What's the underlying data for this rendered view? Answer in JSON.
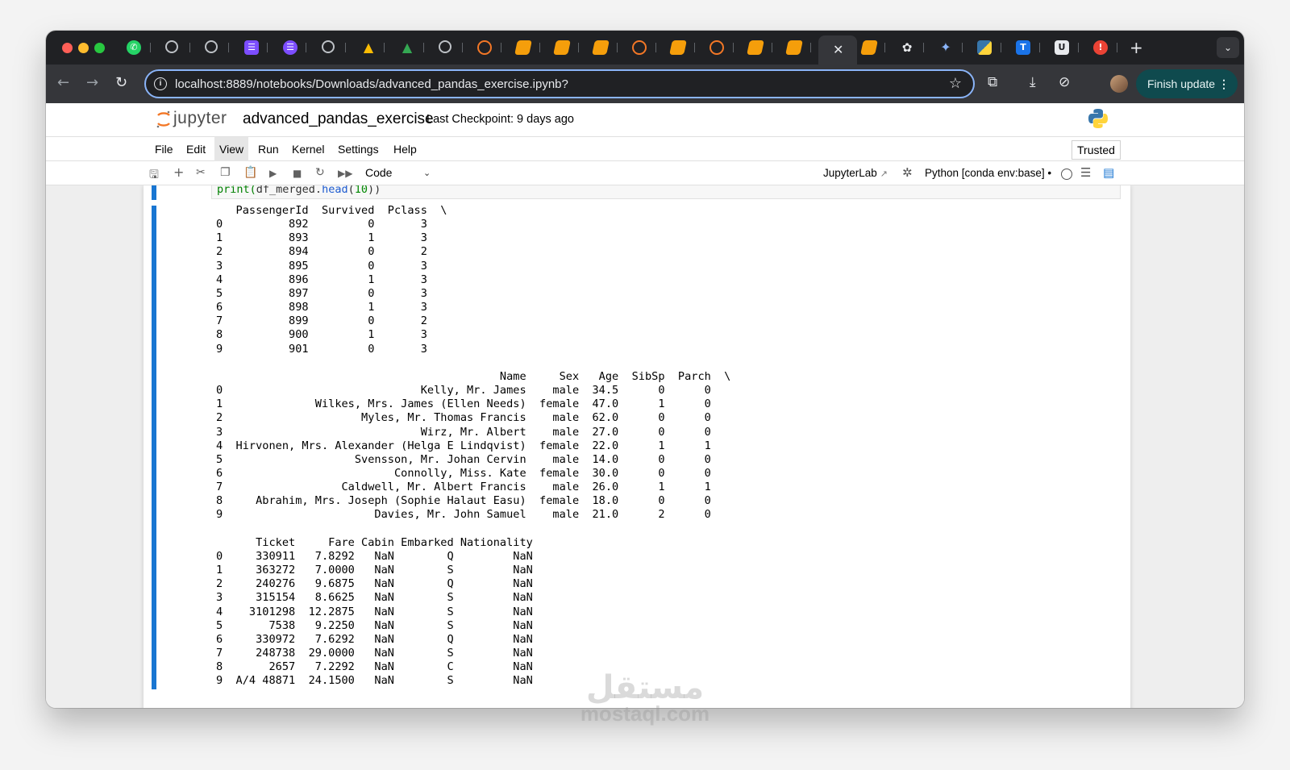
{
  "browser": {
    "url": "localhost:8889/notebooks/Downloads/advanced_pandas_exercise.ipynb?",
    "finish_update_label": "Finish update",
    "close_tab_glyph": "✕",
    "new_tab_glyph": "+"
  },
  "jupyter": {
    "logo_text": "jupyter",
    "notebook_title": "advanced_pandas_exercise",
    "checkpoint": "Last Checkpoint: 9 days ago",
    "menu": [
      "File",
      "Edit",
      "View",
      "Run",
      "Kernel",
      "Settings",
      "Help"
    ],
    "active_menu": "View",
    "trusted_label": "Trusted",
    "cell_type": "Code",
    "jupyterlab_link": "JupyterLab",
    "kernel": "Python [conda env:base] •"
  },
  "cell": {
    "code_prefix": "print(",
    "code_obj": "df_merged.",
    "code_method": "head",
    "code_arg": "10",
    "code_suffix": "))",
    "output": "   PassengerId  Survived  Pclass  \\\n0          892         0       3   \n1          893         1       3   \n2          894         0       2   \n3          895         0       3   \n4          896         1       3   \n5          897         0       3   \n6          898         1       3   \n7          899         0       2   \n8          900         1       3   \n9          901         0       3   \n\n                                           Name     Sex   Age  SibSp  Parch  \\\n0                              Kelly, Mr. James    male  34.5      0      0   \n1              Wilkes, Mrs. James (Ellen Needs)  female  47.0      1      0   \n2                     Myles, Mr. Thomas Francis    male  62.0      0      0   \n3                              Wirz, Mr. Albert    male  27.0      0      0   \n4  Hirvonen, Mrs. Alexander (Helga E Lindqvist)  female  22.0      1      1   \n5                    Svensson, Mr. Johan Cervin    male  14.0      0      0   \n6                          Connolly, Miss. Kate  female  30.0      0      0   \n7                  Caldwell, Mr. Albert Francis    male  26.0      1      1   \n8     Abrahim, Mrs. Joseph (Sophie Halaut Easu)  female  18.0      0      0   \n9                       Davies, Mr. John Samuel    male  21.0      2      0   \n\n      Ticket     Fare Cabin Embarked Nationality  \n0     330911   7.8292   NaN        Q         NaN  \n1     363272   7.0000   NaN        S         NaN  \n2     240276   9.6875   NaN        Q         NaN  \n3     315154   8.6625   NaN        S         NaN  \n4    3101298  12.2875   NaN        S         NaN  \n5       7538   9.2250   NaN        S         NaN  \n6     330972   7.6292   NaN        Q         NaN  \n7     248738  29.0000   NaN        S         NaN  \n8       2657   7.2292   NaN        C         NaN  \n9  A/4 48871  24.1500   NaN        S         NaN  "
  },
  "watermark": {
    "arabic": "مستقل",
    "latin": "mostaql.com"
  }
}
